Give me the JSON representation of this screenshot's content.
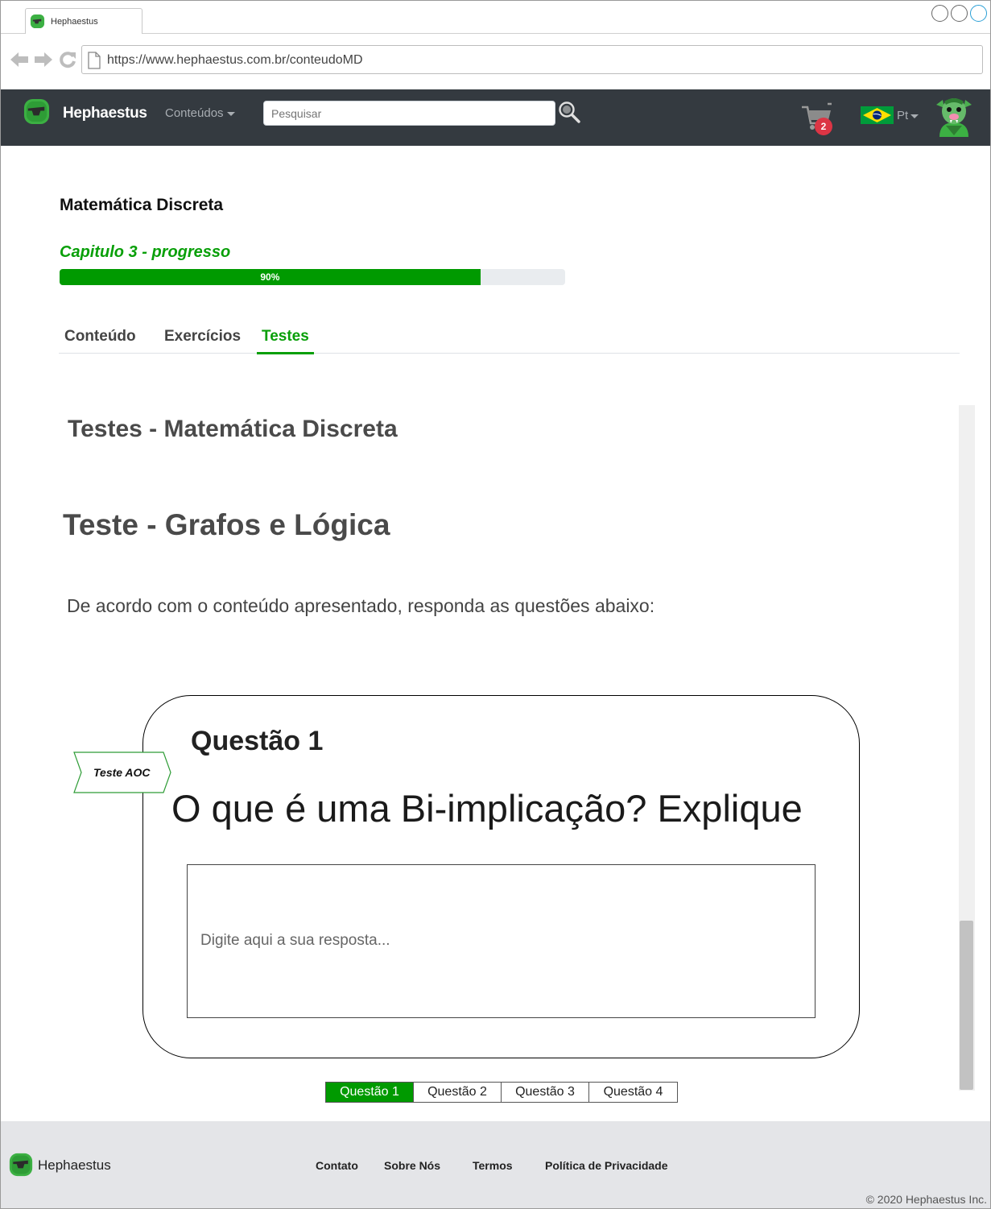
{
  "browser": {
    "tab_title": "Hephaestus",
    "url": "https://www.hephaestus.com.br/conteudoMD"
  },
  "navbar": {
    "brand": "Hephaestus",
    "menu_label": "Conteúdos",
    "search_placeholder": "Pesquisar",
    "cart_count": "2",
    "language": "Pt"
  },
  "course": {
    "title": "Matemática Discreta",
    "progress_label": "Capitulo 3 - progresso",
    "progress_value": 90,
    "progress_text": "90%"
  },
  "tabs": [
    "Conteúdo",
    "Exercícios",
    "Testes"
  ],
  "active_tab": "Testes",
  "main": {
    "section_title": "Testes - Matemática Discreta",
    "test_title": "Teste - Grafos e Lógica",
    "instructions": "De acordo com o conteúdo apresentado, responda as questões abaixo:"
  },
  "question": {
    "tag": "Teste AOC",
    "number": "Questão 1",
    "text": "O que é uma Bi-implicação? Explique",
    "answer_placeholder": "Digite aqui a sua resposta...",
    "answer_value": ""
  },
  "pager": [
    "Questão 1",
    "Questão 2",
    "Questão 3",
    "Questão 4"
  ],
  "pager_active": "Questão 1",
  "footer": {
    "brand": "Hephaestus",
    "links": [
      "Contato",
      "Sobre Nós",
      "Termos",
      "Política de Privacidade"
    ],
    "copyright": "© 2020 Hephaestus Inc."
  },
  "colors": {
    "accent_green": "#089f08",
    "navbar_bg": "#343a40",
    "badge_red": "#dc3545",
    "footer_bg": "#e4e5e8"
  },
  "icons": [
    "back-arrow-icon",
    "forward-arrow-icon",
    "reload-icon",
    "page-icon",
    "logo-icon",
    "search-icon",
    "cart-icon",
    "brazil-flag-icon",
    "avatar-icon"
  ]
}
